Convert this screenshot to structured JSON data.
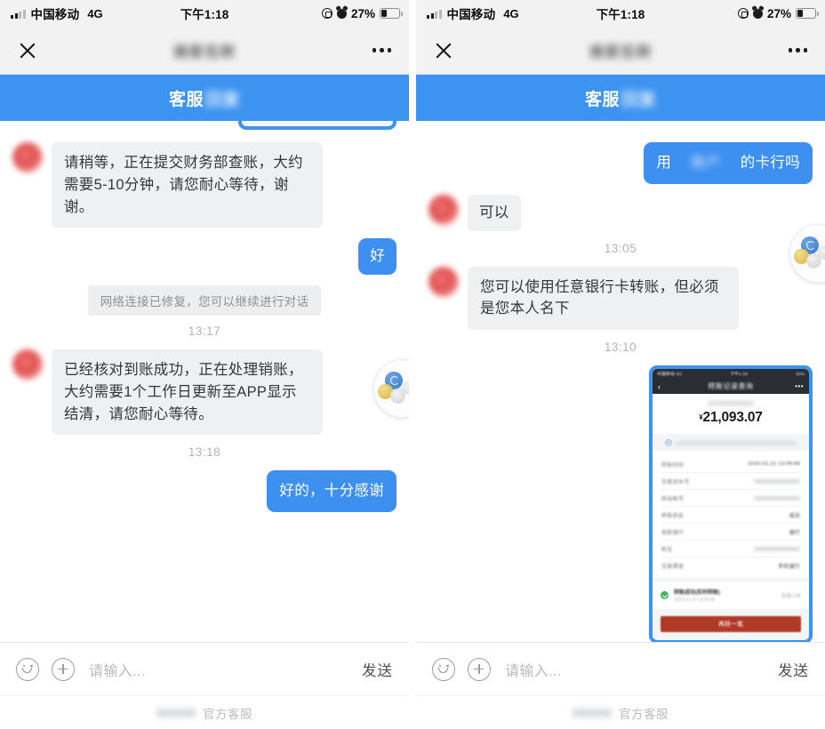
{
  "meta": {
    "accent_blue": "#3d94f0",
    "bubble_agent_bg": "#eef0f2",
    "bubble_user_bg": "#3d8ff0"
  },
  "status_bar": {
    "carrier": "中国移动",
    "network": "4G",
    "time": "下午1:18",
    "battery_percent": "27%",
    "icons": [
      "signal-icon",
      "rotation-lock-icon",
      "alarm-clock-icon",
      "battery-icon"
    ]
  },
  "nav_bar": {
    "close_label": "✕",
    "title_blurred": "商家名称",
    "more_label": "•••"
  },
  "banner": {
    "prefix": "客服",
    "blurred_suffix": "回复"
  },
  "left_panel": {
    "messages": [
      {
        "type": "image-agent",
        "name": "transfer-receipt-image"
      },
      {
        "type": "agent",
        "text": "请稍等，正在提交财务部查账，大约需要5-10分钟，请您耐心等待，谢谢。"
      },
      {
        "type": "user",
        "text": "好"
      },
      {
        "type": "system",
        "text": "网络连接已修复，您可以继续进行对话"
      },
      {
        "type": "timestamp",
        "text": "13:17"
      },
      {
        "type": "agent",
        "text": "已经核对到账成功，正在处理销账，大约需要1个工作日更新至APP显示结清，请您耐心等待。"
      },
      {
        "type": "timestamp",
        "text": "13:18"
      },
      {
        "type": "user",
        "text": "好的，十分感谢"
      }
    ],
    "input": {
      "placeholder": "请输入...",
      "send_label": "发送"
    },
    "footer": {
      "blurred": "平台名",
      "text": "官方客服"
    }
  },
  "right_panel": {
    "messages": [
      {
        "type": "user",
        "text": "用 的卡行吗",
        "has_blur": true
      },
      {
        "type": "agent",
        "text": "可以"
      },
      {
        "type": "timestamp",
        "text": "13:05"
      },
      {
        "type": "agent",
        "text": "您可以使用任意银行卡转账，但必须是您本人名下"
      },
      {
        "type": "timestamp",
        "text": "13:10"
      },
      {
        "type": "image-agent",
        "name": "transfer-receipt-image"
      }
    ],
    "input": {
      "placeholder": "请输入...",
      "send_label": "发送"
    },
    "footer": {
      "blurred": "平台名",
      "text": "官方客服"
    }
  },
  "receipt_screenshot": {
    "status_left": "中国移动 4G",
    "status_center": "下午1:10",
    "status_right": "32%",
    "nav_back": "‹",
    "nav_title": "转账记录查询",
    "nav_more": "•••",
    "currency": "¥",
    "amount": "21,093.07",
    "rows": [
      {
        "label": "转账时间",
        "value": "2020.02.22 13:09:48",
        "blur_value": false
      },
      {
        "label": "交易流水号",
        "value": "",
        "blur_value": true
      },
      {
        "label": "转出账号",
        "value": "",
        "blur_value": true
      },
      {
        "label": "转账状态",
        "value": "成功",
        "blur_value": false
      },
      {
        "label": "收款银行",
        "value": "银行",
        "blur_value": false
      },
      {
        "label": "附言",
        "value": "",
        "blur_value": true
      },
      {
        "label": "交易渠道",
        "value": "手机银行",
        "blur_value": false
      }
    ],
    "success_title": "转账成功(实时转账)",
    "success_time": "2020.02.22 13:09:48",
    "success_link": "查看订单",
    "button_label": "再转一笔"
  }
}
